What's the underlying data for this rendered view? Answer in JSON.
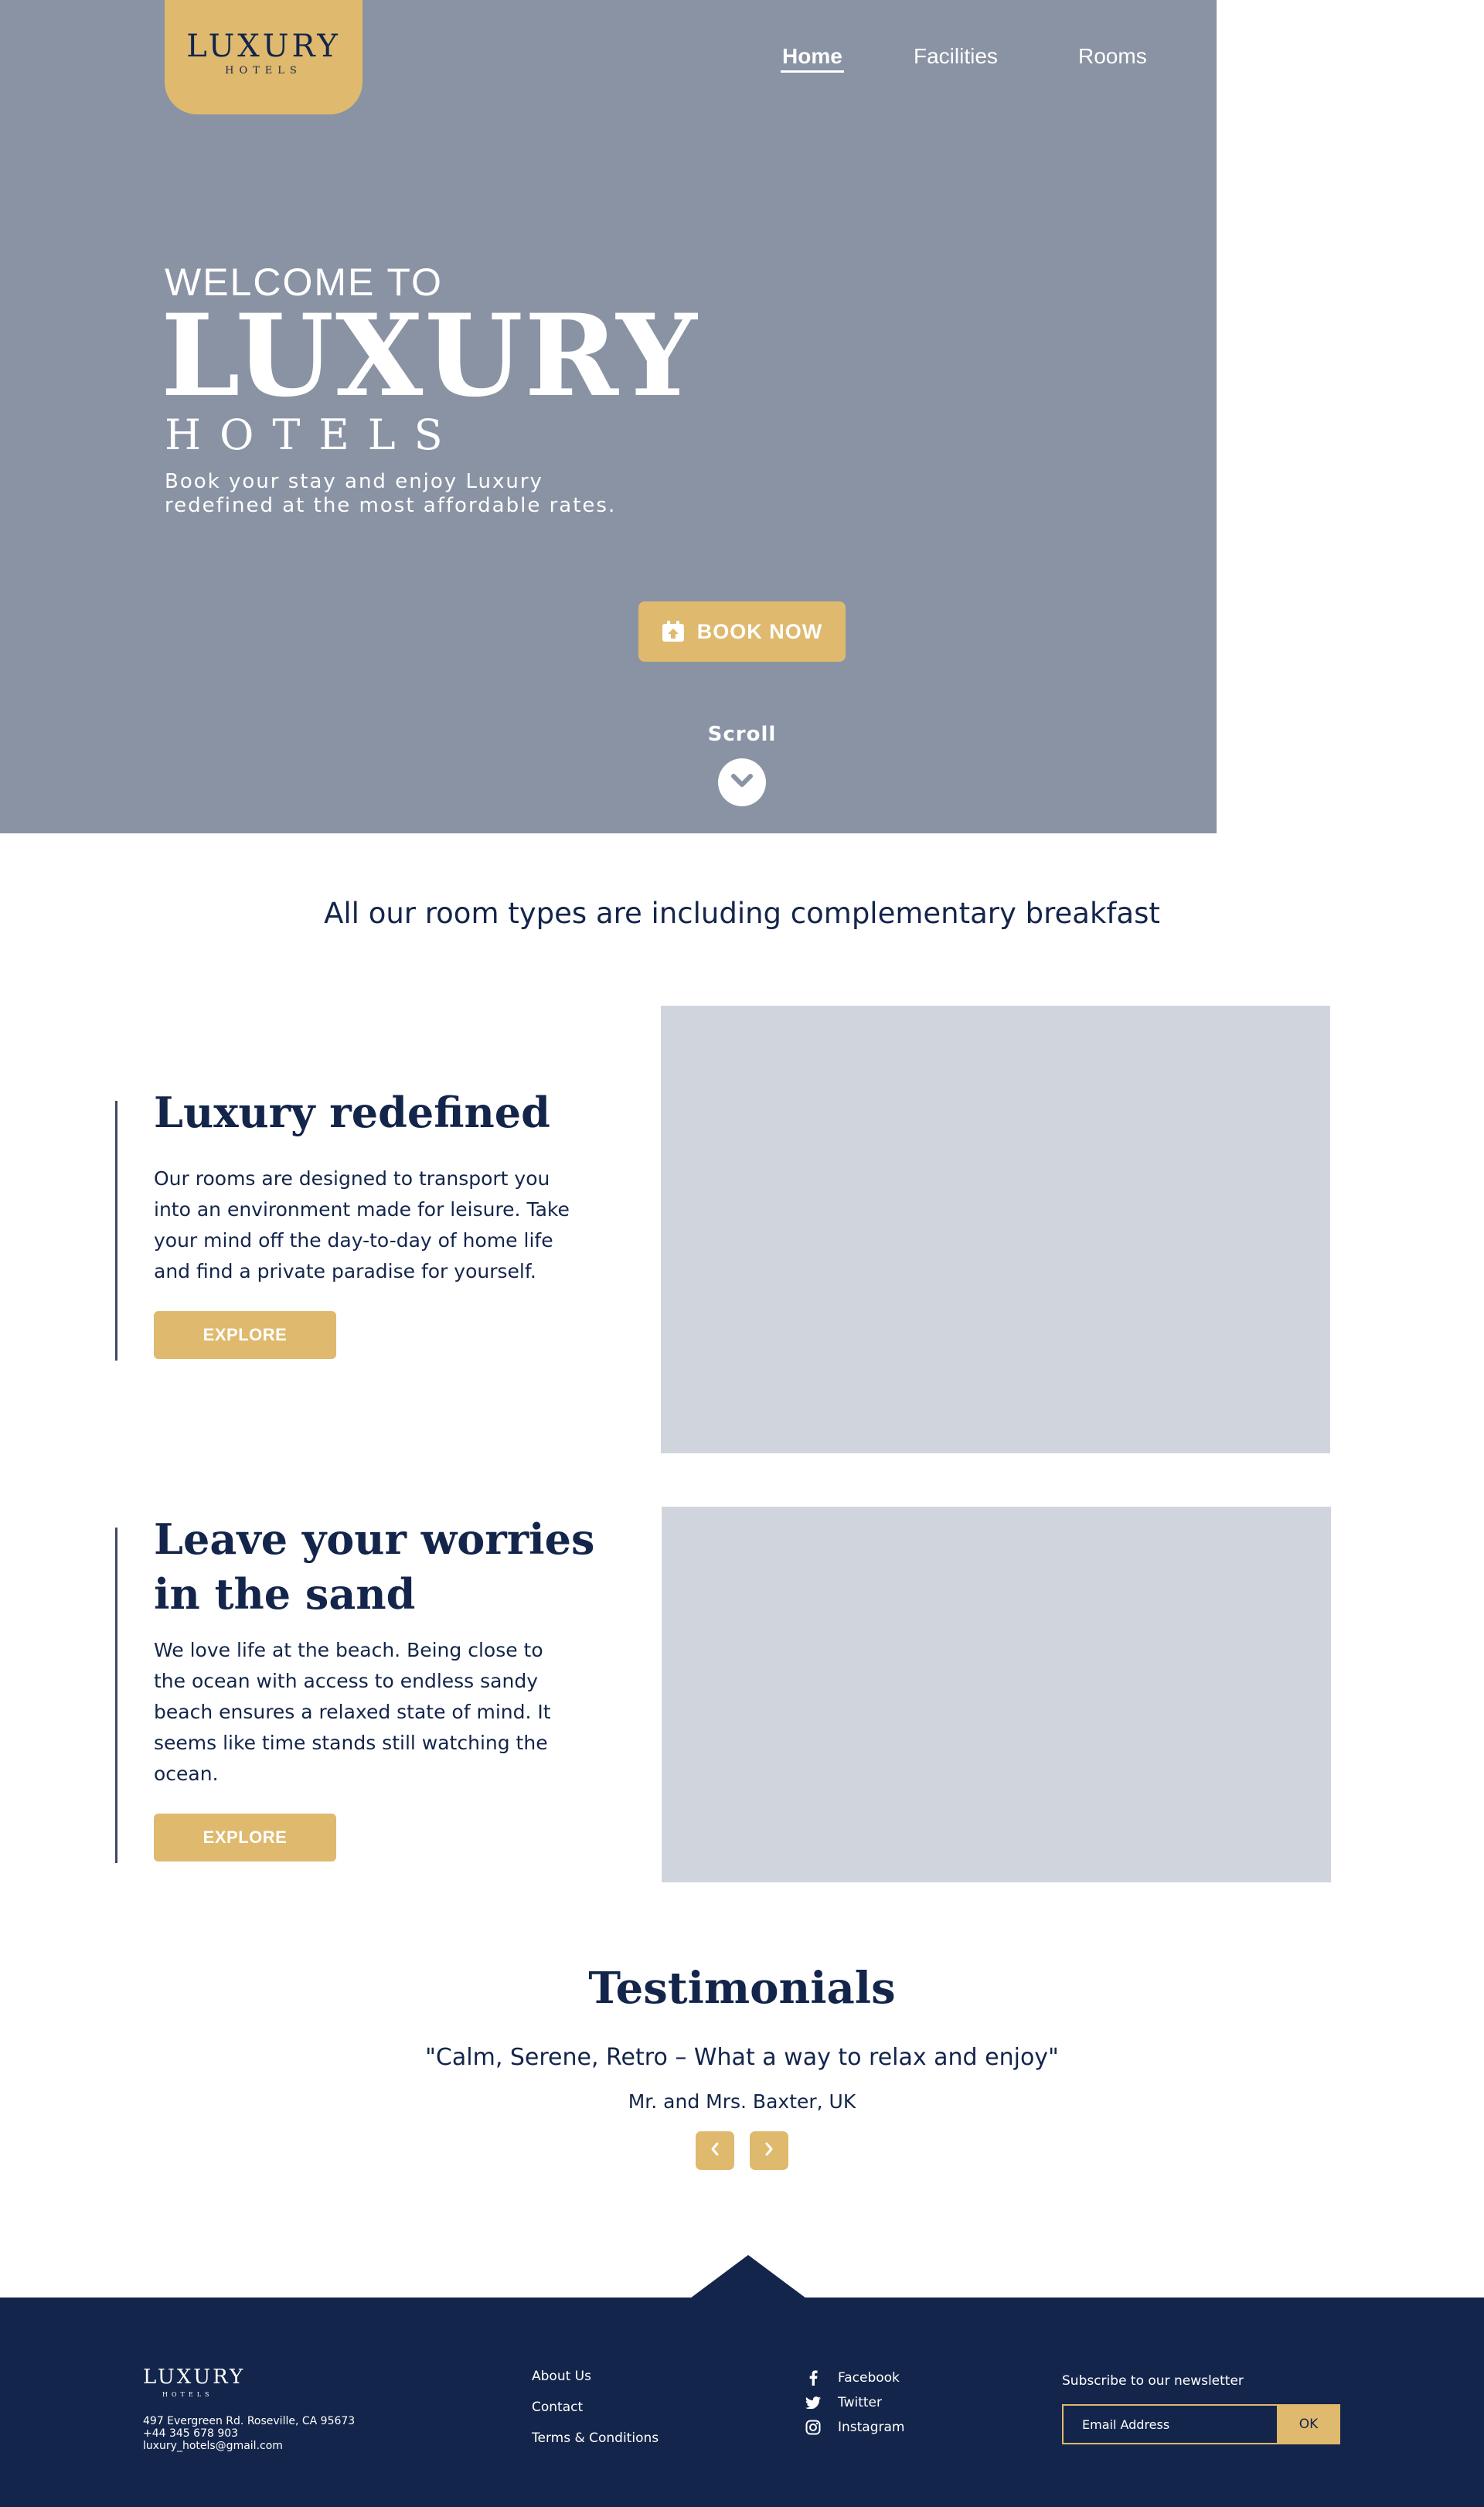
{
  "brand": {
    "name": "LUXURY",
    "sub": "HOTELS"
  },
  "nav": {
    "home": "Home",
    "facilities": "Facilities",
    "rooms": "Rooms"
  },
  "hero": {
    "welcome": "WELCOME TO",
    "title": "LUXURY",
    "subtitle": "HOTELS",
    "tagline": "Book your stay and enjoy Luxury redefined at the most affordable rates.",
    "book_label": "BOOK NOW",
    "scroll_label": "Scroll"
  },
  "breakfast": "All our room types are including complementary breakfast",
  "features": [
    {
      "title": "Luxury redefined",
      "text": "Our rooms are designed to transport you into an environment made for leisure. Take your mind off the day-to-day of home life and find a private paradise for yourself.",
      "button": "EXPLORE"
    },
    {
      "title": "Leave your worries in the sand",
      "text": "We love life at the beach. Being close to the ocean with access to endless sandy beach ensures a relaxed state of mind. It seems like time stands still watching the ocean.",
      "button": "EXPLORE"
    }
  ],
  "testimonials": {
    "title": "Testimonials",
    "quote": "\"Calm, Serene, Retro – What a way to relax and enjoy\"",
    "author": "Mr. and Mrs. Baxter, UK"
  },
  "footer": {
    "logo": "LUXURY",
    "logo_sub": "HOTELS",
    "address": "497 Evergreen Rd. Roseville, CA 95673",
    "phone": "+44 345 678 903",
    "email": "luxury_hotels@gmail.com",
    "links": [
      "About Us",
      "Contact",
      "Terms & Conditions"
    ],
    "social": [
      {
        "label": "Facebook",
        "icon": "facebook-icon"
      },
      {
        "label": "Twitter",
        "icon": "twitter-icon"
      },
      {
        "label": "Instagram",
        "icon": "instagram-icon"
      }
    ],
    "newsletter_title": "Subscribe to our newsletter",
    "email_placeholder": "Email Address",
    "ok_label": "OK"
  },
  "colors": {
    "hero_bg": "#8a93a4",
    "accent": "#dfb96e",
    "navy": "#14254b",
    "image_placeholder": "#d0d5dd"
  }
}
